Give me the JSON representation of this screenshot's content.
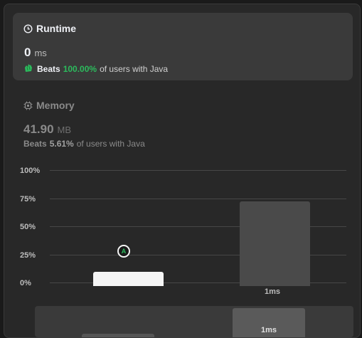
{
  "runtime": {
    "title": "Runtime",
    "value": "0",
    "unit": "ms",
    "beats_prefix": "Beats",
    "beats_pct": "100.00%",
    "beats_suffix": "of users with Java",
    "icon": "clock-icon"
  },
  "memory": {
    "title": "Memory",
    "value": "41.90",
    "unit": "MB",
    "beats_prefix": "Beats",
    "beats_pct": "5.61%",
    "beats_suffix": "of users with Java",
    "icon": "chip-icon"
  },
  "chart_data": {
    "type": "bar",
    "y_ticks": [
      "100%",
      "75%",
      "50%",
      "25%",
      "0%"
    ],
    "ylim": [
      0,
      100
    ],
    "bars": [
      {
        "label": "",
        "value": 12.5,
        "highlighted": true,
        "marker": "A"
      },
      {
        "label": "1ms",
        "value": 75,
        "highlighted": false
      }
    ],
    "overview_bars": [
      {
        "label": "",
        "value": 12
      },
      {
        "label": "1ms",
        "value": 75
      }
    ]
  },
  "colors": {
    "accent_green": "#2cbb5d",
    "highlight_bar": "#f5f5f5",
    "bar": "#4a4a4a"
  }
}
